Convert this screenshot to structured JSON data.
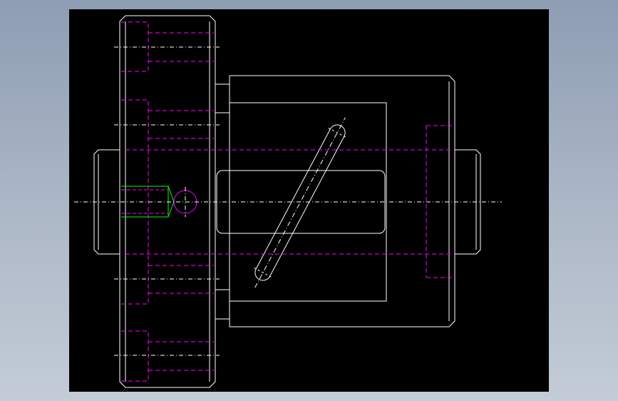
{
  "viewport": {
    "background_color": "#000000",
    "outer_gradient_top": "#8e9db3",
    "outer_gradient_bottom": "#c3ccd7"
  },
  "line_colors": {
    "outline": "#ffffff",
    "hidden": "#ff00ff",
    "centerline": "#ffffff",
    "thread": "#00ff00"
  }
}
